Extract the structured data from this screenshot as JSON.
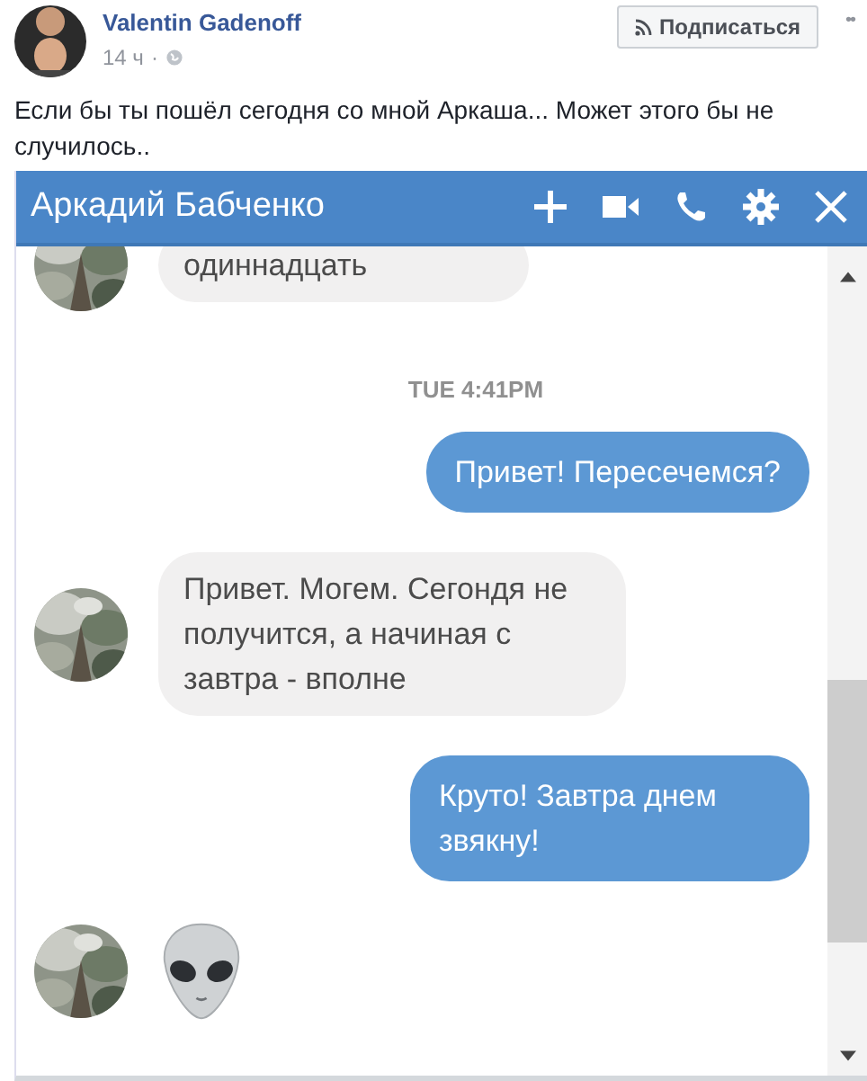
{
  "post": {
    "author": "Valentin Gadenoff",
    "time": "14 ч",
    "separator": "·",
    "subscribe": "Подписаться",
    "more": "••",
    "text": "Если бы ты пошёл сегодня со мной Аркаша... Может этого бы не случилось.."
  },
  "chat": {
    "title": "Аркадий Бабченко",
    "messages": [
      {
        "kind": "incoming",
        "text": "одиннадцать"
      },
      {
        "kind": "timestamp",
        "text": "TUE 4:41PM"
      },
      {
        "kind": "outgoing",
        "text": "Привет!  Пересечемся?"
      },
      {
        "kind": "incoming",
        "text": "Привет. Могем. Сегондя не получится, а начиная с завтра - вполне"
      },
      {
        "kind": "outgoing",
        "text": "Круто! Завтра днем звякну!"
      },
      {
        "kind": "emoji"
      }
    ]
  }
}
